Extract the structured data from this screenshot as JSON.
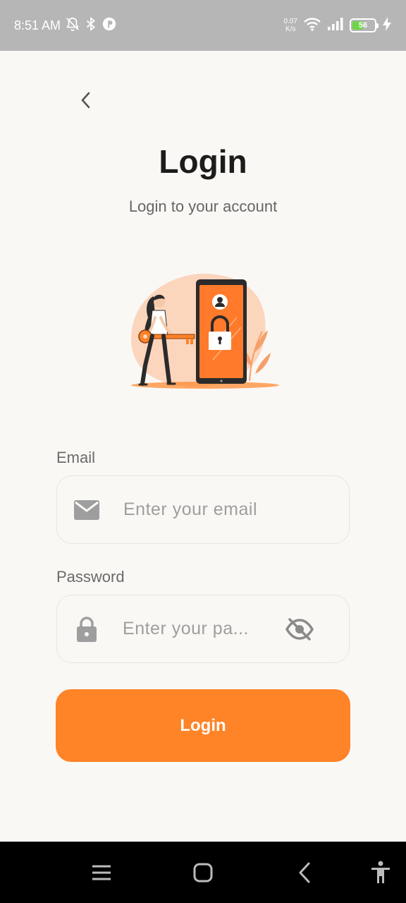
{
  "status_bar": {
    "time": "8:51 AM",
    "net_speed_value": "0.07",
    "net_speed_unit": "K/s",
    "battery_level": "56",
    "battery_fraction": 0.56,
    "icons": [
      "mute-icon",
      "bluetooth-icon",
      "app-icon",
      "wifi-icon",
      "signal-icon",
      "battery-icon",
      "charging-icon"
    ]
  },
  "header": {
    "title": "Login",
    "subtitle": "Login to your account"
  },
  "form": {
    "email": {
      "label": "Email",
      "placeholder": "Enter your email",
      "value": ""
    },
    "password": {
      "label": "Password",
      "placeholder": "Enter your pa...",
      "value": ""
    },
    "submit_label": "Login"
  },
  "colors": {
    "accent": "#ff8327",
    "background": "#faf8f5",
    "status_bar": "#b6b6b6",
    "nav_bar": "#000000"
  },
  "nav_bar": {
    "icons": [
      "menu-icon",
      "home-icon",
      "back-icon",
      "accessibility-icon"
    ]
  }
}
